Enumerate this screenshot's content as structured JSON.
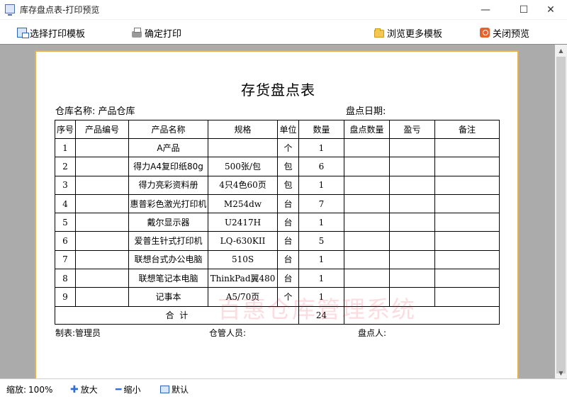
{
  "window": {
    "title": "库存盘点表-打印预览",
    "minimize_glyph": "—",
    "maximize_glyph": "☐",
    "close_glyph": "✕"
  },
  "toolbar": {
    "select_template": "选择打印模板",
    "confirm_print": "确定打印",
    "browse_templates": "浏览更多模板",
    "close_preview": "关闭预览"
  },
  "document": {
    "title": "存货盘点表",
    "warehouse_label": "仓库名称:",
    "warehouse_value": "产品仓库",
    "date_label": "盘点日期:",
    "columns": [
      "序号",
      "产品编号",
      "产品名称",
      "规格",
      "单位",
      "数量",
      "盘点数量",
      "盈亏",
      "备注"
    ],
    "rows": [
      {
        "no": "1",
        "code": "",
        "name": "A产品",
        "spec": "",
        "unit": "个",
        "qty": "1"
      },
      {
        "no": "2",
        "code": "",
        "name": "得力A4复印纸80g",
        "spec": "500张/包",
        "unit": "包",
        "qty": "6"
      },
      {
        "no": "3",
        "code": "",
        "name": "得力亮彩资料册",
        "spec": "4只4色60页",
        "unit": "包",
        "qty": "1"
      },
      {
        "no": "4",
        "code": "",
        "name": "惠普彩色激光打印机",
        "spec": "M254dw",
        "unit": "台",
        "qty": "7"
      },
      {
        "no": "5",
        "code": "",
        "name": "戴尔显示器",
        "spec": "U2417H",
        "unit": "台",
        "qty": "1"
      },
      {
        "no": "6",
        "code": "",
        "name": "爱普生针式打印机",
        "spec": "LQ-630KII",
        "unit": "台",
        "qty": "5"
      },
      {
        "no": "7",
        "code": "",
        "name": "联想台式办公电脑",
        "spec": "510S",
        "unit": "台",
        "qty": "1"
      },
      {
        "no": "8",
        "code": "",
        "name": "联想笔记本电脑",
        "spec": "ThinkPad翼480",
        "unit": "台",
        "qty": "1"
      },
      {
        "no": "9",
        "code": "",
        "name": "记事本",
        "spec": "A5/70页",
        "unit": "个",
        "qty": "1"
      }
    ],
    "total_label": "合  计",
    "total_qty": "24",
    "maker_label": "制表:",
    "maker_value": "管理员",
    "keeper_label": "仓管人员:",
    "counter_label": "盘点人:",
    "watermark": "百惠仓库管理系统"
  },
  "scrollbar": {
    "up_glyph": "▲",
    "down_glyph": "▼"
  },
  "statusbar": {
    "zoom_label": "缩放:",
    "zoom_value": "100%",
    "zoom_in": "放大",
    "zoom_out": "缩小",
    "default": "默认"
  },
  "colors": {
    "page_border": "#e6b14a",
    "preview_bg": "#ababab",
    "watermark": "#e6283c"
  }
}
